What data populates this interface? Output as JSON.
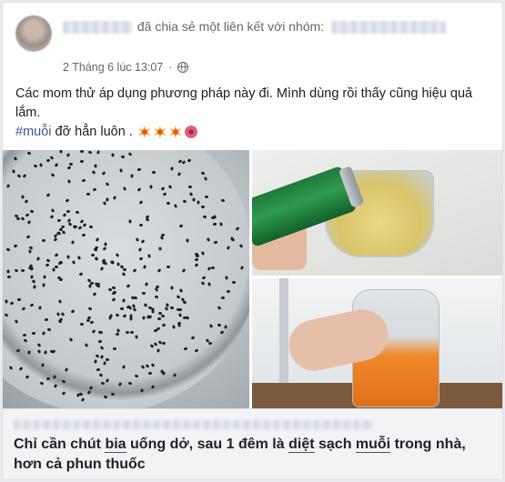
{
  "post": {
    "shared_text": "đã chia sẻ một liên kết với nhóm:",
    "date": "2 Tháng 6 lúc 13:07",
    "privacy_icon": "globe-icon",
    "body_line1": "Các mom thử áp dụng phương pháp này đi. Mình dùng rồi thấy cũng hiệu quả lắm.",
    "hashtag": "#muỗi",
    "body_line2_rest": " đỡ hẳn luôn .",
    "emojis": [
      "sparkle-emoji",
      "sparkle-emoji",
      "sparkle-emoji",
      "flower-emoji"
    ]
  },
  "link": {
    "title_parts": [
      {
        "t": "Chỉ cần chút ",
        "hl": false
      },
      {
        "t": "bia",
        "hl": true
      },
      {
        "t": " uống dở, sau 1 đêm là ",
        "hl": false
      },
      {
        "t": "diệt",
        "hl": true
      },
      {
        "t": " sạch ",
        "hl": false
      },
      {
        "t": "muỗi",
        "hl": true
      },
      {
        "t": " trong nhà, hơn cả phun thuốc",
        "hl": false
      }
    ]
  },
  "colors": {
    "link_blue": "#385898",
    "card_bg": "#ffffff",
    "page_bg": "#e9ebee",
    "link_box_bg": "#f2f3f5"
  }
}
